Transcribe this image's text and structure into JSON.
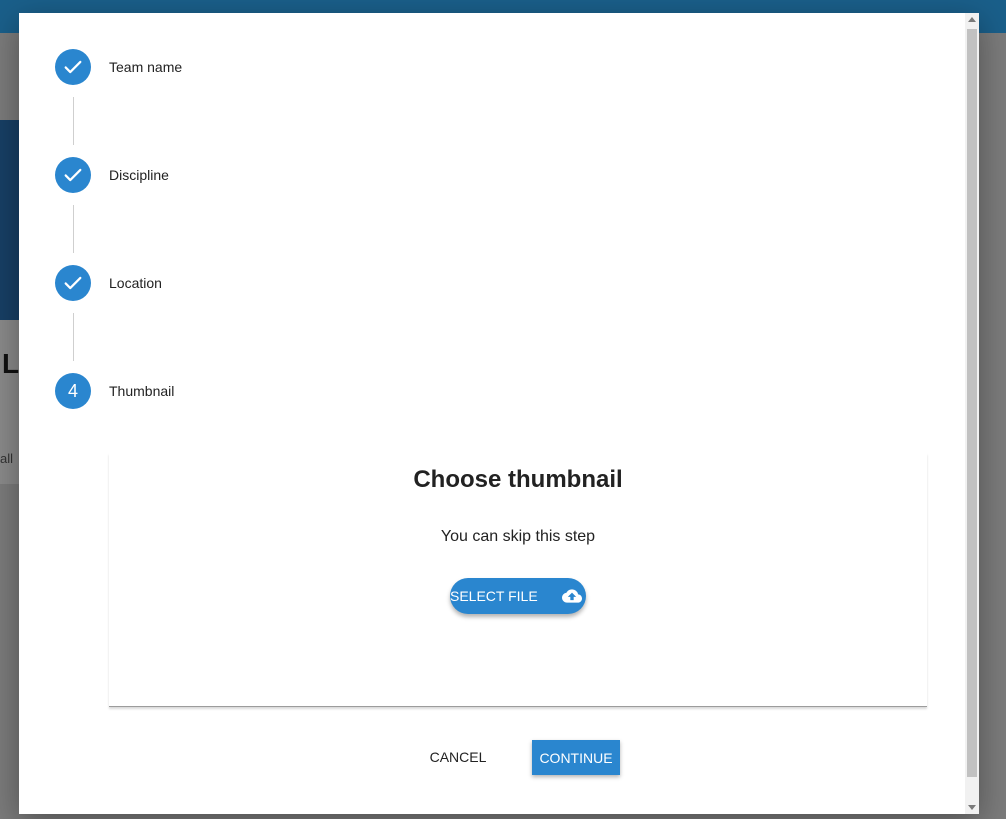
{
  "background": {
    "letter": "L",
    "snippet": "all"
  },
  "stepper": {
    "steps": [
      {
        "label": "Team name",
        "state": "completed",
        "icon": "check-icon"
      },
      {
        "label": "Discipline",
        "state": "completed",
        "icon": "check-icon"
      },
      {
        "label": "Location",
        "state": "completed",
        "icon": "check-icon"
      },
      {
        "label": "Thumbnail",
        "state": "active",
        "number": "4"
      }
    ]
  },
  "content": {
    "title": "Choose thumbnail",
    "subtitle": "You can skip this step",
    "select_file_label": "SELECT FILE",
    "select_file_icon": "cloud-upload-icon"
  },
  "actions": {
    "cancel_label": "CANCEL",
    "continue_label": "CONTINUE"
  },
  "colors": {
    "accent": "#2a86cf",
    "appbar": "#1a5f8a"
  }
}
